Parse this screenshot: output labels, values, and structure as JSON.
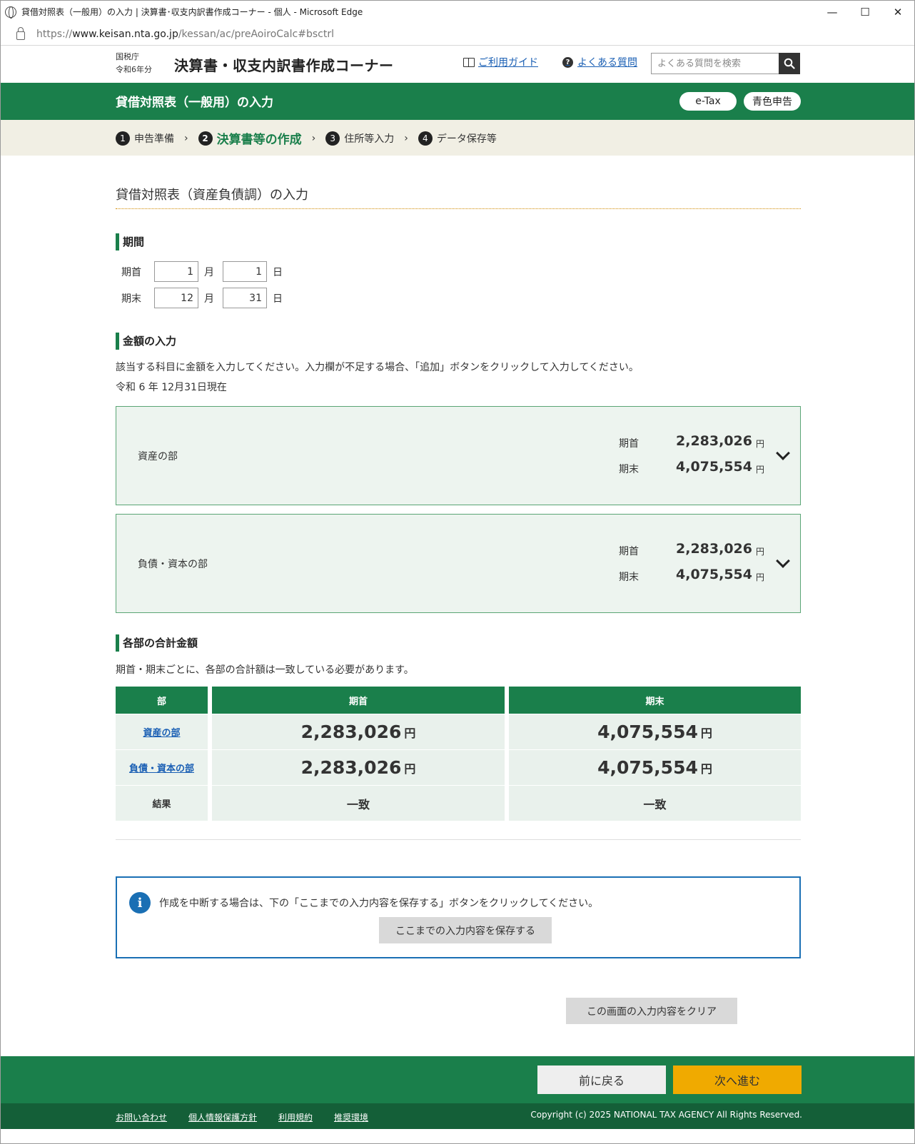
{
  "browser": {
    "window_title": "貸借対照表（一般用）の入力 | 決算書･収支内訳書作成コーナー - 個人 - Microsoft Edge",
    "url_prefix": "https://",
    "url_host": "www.keisan.nta.go.jp",
    "url_path": "/kessan/ac/preAoiroCalc#bsctrl",
    "minimize": "—",
    "maximize": "☐",
    "close": "✕"
  },
  "header": {
    "agency": "国税庁",
    "year": "令和6年分",
    "title": "決算書・収支内訳書作成コーナー",
    "guide_link": "ご利用ガイド",
    "faq_link": "よくある質問",
    "search_placeholder": "よくある質問を検索"
  },
  "greenbar": {
    "title": "貸借対照表（一般用）の入力",
    "etax": "e-Tax",
    "aoiro": "青色申告"
  },
  "steps": [
    {
      "num": "1",
      "label": "申告準備"
    },
    {
      "num": "2",
      "label": "決算書等の作成"
    },
    {
      "num": "3",
      "label": "住所等入力"
    },
    {
      "num": "4",
      "label": "データ保存等"
    }
  ],
  "step_separator": "›",
  "main": {
    "heading": "貸借対照表（資産負債調）の入力",
    "period_section": "期間",
    "period_start_label": "期首",
    "period_end_label": "期末",
    "month_unit": "月",
    "day_unit": "日",
    "start_month": "1",
    "start_day": "1",
    "end_month": "12",
    "end_day": "31",
    "amount_section": "金額の入力",
    "amount_note": "該当する科目に金額を入力してください。入力欄が不足する場合、「追加」ボタンをクリックして入力してください。",
    "as_of": "令和 6 年 12月31日現在"
  },
  "accordions": [
    {
      "name": "資産の部",
      "start_label": "期首",
      "start_value": "2,283,026",
      "end_label": "期末",
      "end_value": "4,075,554",
      "yen": "円"
    },
    {
      "name": "負債・資本の部",
      "start_label": "期首",
      "start_value": "2,283,026",
      "end_label": "期末",
      "end_value": "4,075,554",
      "yen": "円"
    }
  ],
  "totals": {
    "section": "各部の合計金額",
    "note": "期首・期末ごとに、各部の合計額は一致している必要があります。",
    "headers": [
      "部",
      "期首",
      "期末"
    ],
    "rows": [
      {
        "name": "資産の部",
        "start": "2,283,026",
        "end": "4,075,554"
      },
      {
        "name": "負債・資本の部",
        "start": "2,283,026",
        "end": "4,075,554"
      }
    ],
    "yen": "円",
    "result_label": "結果",
    "result_start": "一致",
    "result_end": "一致"
  },
  "info": {
    "icon": "i",
    "text": "作成を中断する場合は、下の「ここまでの入力内容を保存する」ボタンをクリックしてください。",
    "save_button": "ここまでの入力内容を保存する"
  },
  "clear_button": "この画面の入力内容をクリア",
  "nav": {
    "back": "前に戻る",
    "next": "次へ進む"
  },
  "footer": {
    "links": [
      "お問い合わせ",
      "個人情報保護方針",
      "利用規約",
      "推奨環境"
    ],
    "copyright": "Copyright (c) 2025 NATIONAL TAX AGENCY All Rights Reserved."
  },
  "colors": {
    "brand_green": "#1a7f4b",
    "link_blue": "#1a5fb4",
    "next_orange": "#f0aa00"
  }
}
